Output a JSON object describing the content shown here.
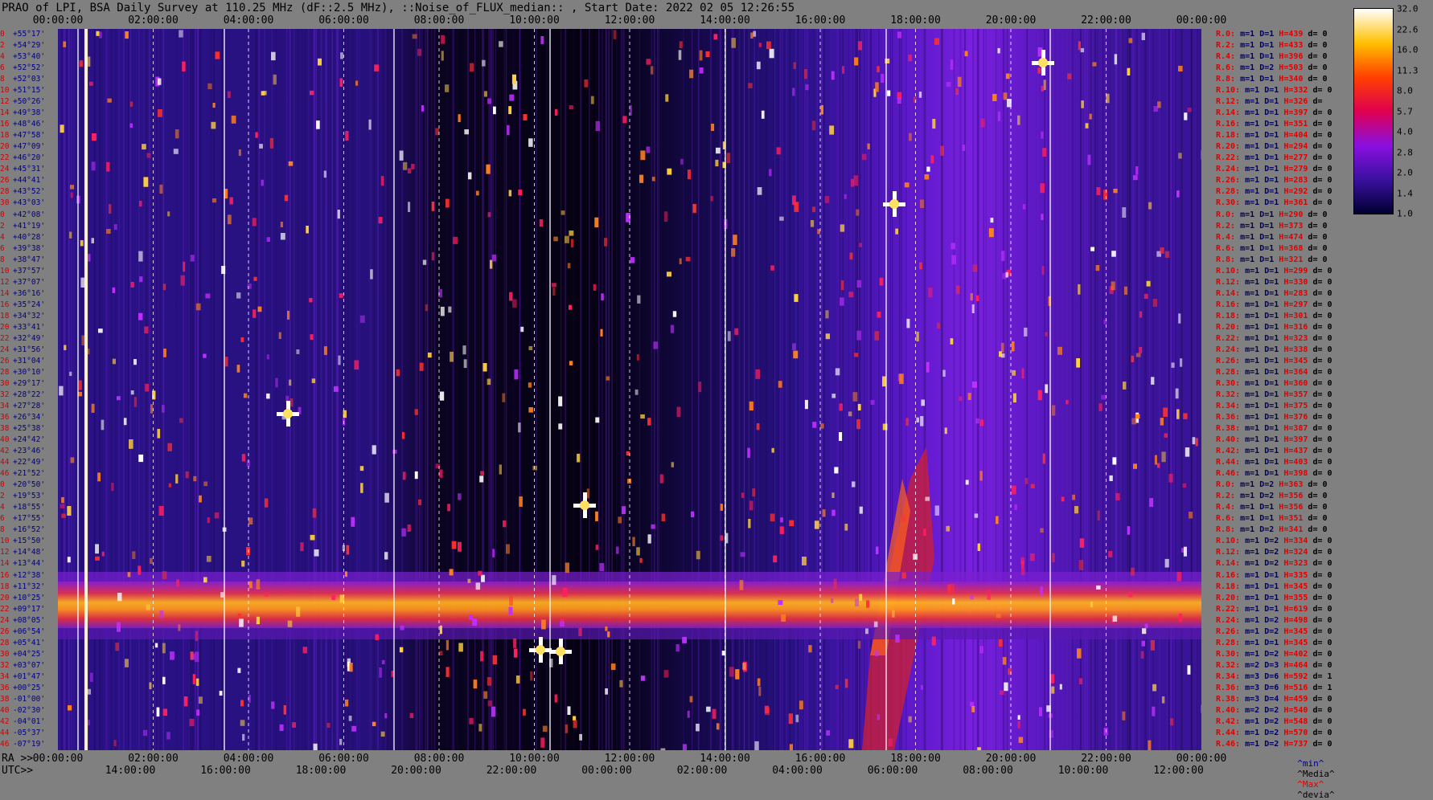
{
  "title": "PRAO of LPI, BSA Daily Survey at 110.25 MHz (dF::2.5 MHz), ::Noise_of_FLUX_median:: , Start Date: 2022 02 05 12:26:55",
  "chart_data": {
    "type": "heatmap",
    "top_ticks": [
      "00:00:00",
      "02:00:00",
      "04:00:00",
      "06:00:00",
      "08:00:00",
      "10:00:00",
      "12:00:00",
      "14:00:00",
      "16:00:00",
      "18:00:00",
      "20:00:00",
      "22:00:00",
      "00:00:00"
    ],
    "ra_prefix": "RA >>",
    "ra_ticks": [
      "00:00:00",
      "02:00:00",
      "04:00:00",
      "06:00:00",
      "08:00:00",
      "10:00:00",
      "12:00:00",
      "14:00:00",
      "16:00:00",
      "18:00:00",
      "20:00:00",
      "22:00:00",
      "00:00:00"
    ],
    "utc_prefix": "UTC>>",
    "utc_ticks": [
      "14:00:00",
      "16:00:00",
      "18:00:00",
      "20:00:00",
      "22:00:00",
      "00:00:00",
      "02:00:00",
      "04:00:00",
      "06:00:00",
      "08:00:00",
      "10:00:00",
      "12:00:00"
    ],
    "declinations": [
      {
        "idx": "0",
        "dec": "+55°17'"
      },
      {
        "idx": "2",
        "dec": "+54°29'"
      },
      {
        "idx": "4",
        "dec": "+53°40'"
      },
      {
        "idx": "6",
        "dec": "+52°52'"
      },
      {
        "idx": "8",
        "dec": "+52°03'"
      },
      {
        "idx": "10",
        "dec": "+51°15'"
      },
      {
        "idx": "12",
        "dec": "+50°26'"
      },
      {
        "idx": "14",
        "dec": "+49°38'"
      },
      {
        "idx": "16",
        "dec": "+48°46'"
      },
      {
        "idx": "18",
        "dec": "+47°58'"
      },
      {
        "idx": "20",
        "dec": "+47°09'"
      },
      {
        "idx": "22",
        "dec": "+46°20'"
      },
      {
        "idx": "24",
        "dec": "+45°31'"
      },
      {
        "idx": "26",
        "dec": "+44°41'"
      },
      {
        "idx": "28",
        "dec": "+43°52'"
      },
      {
        "idx": "30",
        "dec": "+43°03'"
      },
      {
        "idx": "0",
        "dec": "+42°08'"
      },
      {
        "idx": "2",
        "dec": "+41°19'"
      },
      {
        "idx": "4",
        "dec": "+40°28'"
      },
      {
        "idx": "6",
        "dec": "+39°38'"
      },
      {
        "idx": "8",
        "dec": "+38°47'"
      },
      {
        "idx": "10",
        "dec": "+37°57'"
      },
      {
        "idx": "12",
        "dec": "+37°07'"
      },
      {
        "idx": "14",
        "dec": "+36°16'"
      },
      {
        "idx": "16",
        "dec": "+35°24'"
      },
      {
        "idx": "18",
        "dec": "+34°32'"
      },
      {
        "idx": "20",
        "dec": "+33°41'"
      },
      {
        "idx": "22",
        "dec": "+32°49'"
      },
      {
        "idx": "24",
        "dec": "+31°56'"
      },
      {
        "idx": "26",
        "dec": "+31°04'"
      },
      {
        "idx": "28",
        "dec": "+30°10'"
      },
      {
        "idx": "30",
        "dec": "+29°17'"
      },
      {
        "idx": "32",
        "dec": "+28°22'"
      },
      {
        "idx": "34",
        "dec": "+27°28'"
      },
      {
        "idx": "36",
        "dec": "+26°34'"
      },
      {
        "idx": "38",
        "dec": "+25°38'"
      },
      {
        "idx": "40",
        "dec": "+24°42'"
      },
      {
        "idx": "42",
        "dec": "+23°46'"
      },
      {
        "idx": "44",
        "dec": "+22°49'"
      },
      {
        "idx": "46",
        "dec": "+21°52'"
      },
      {
        "idx": "0",
        "dec": "+20°50'"
      },
      {
        "idx": "2",
        "dec": "+19°53'"
      },
      {
        "idx": "4",
        "dec": "+18°55'"
      },
      {
        "idx": "6",
        "dec": "+17°55'"
      },
      {
        "idx": "8",
        "dec": "+16°52'"
      },
      {
        "idx": "10",
        "dec": "+15°50'"
      },
      {
        "idx": "12",
        "dec": "+14°48'"
      },
      {
        "idx": "14",
        "dec": "+13°44'"
      },
      {
        "idx": "16",
        "dec": "+12°38'"
      },
      {
        "idx": "18",
        "dec": "+11°32'"
      },
      {
        "idx": "20",
        "dec": "+10°25'"
      },
      {
        "idx": "22",
        "dec": "+09°17'"
      },
      {
        "idx": "24",
        "dec": "+08°05'"
      },
      {
        "idx": "26",
        "dec": "+06°54'"
      },
      {
        "idx": "28",
        "dec": "+05°41'"
      },
      {
        "idx": "30",
        "dec": "+04°25'"
      },
      {
        "idx": "32",
        "dec": "+03°07'"
      },
      {
        "idx": "34",
        "dec": "+01°47'"
      },
      {
        "idx": "36",
        "dec": "+00°25'"
      },
      {
        "idx": "38",
        "dec": "-01°00'"
      },
      {
        "idx": "40",
        "dec": "-02°30'"
      },
      {
        "idx": "42",
        "dec": "-04°01'"
      },
      {
        "idx": "44",
        "dec": "-05°37'"
      },
      {
        "idx": "46",
        "dec": "-07°19'"
      }
    ],
    "receivers": [
      {
        "id": "R.0:",
        "m": "m=1",
        "d": "D=1",
        "h": "H=439",
        "dd": "d= 0"
      },
      {
        "id": "R.2:",
        "m": "m=1",
        "d": "D=1",
        "h": "H=433",
        "dd": "d= 0"
      },
      {
        "id": "R.4:",
        "m": "m=1",
        "d": "D=1",
        "h": "H=396",
        "dd": "d= 0"
      },
      {
        "id": "R.6:",
        "m": "m=1",
        "d": "D=2",
        "h": "H=503",
        "dd": "d= 0"
      },
      {
        "id": "R.8:",
        "m": "m=1",
        "d": "D=1",
        "h": "H=340",
        "dd": "d= 0"
      },
      {
        "id": "R.10:",
        "m": "m=1",
        "d": "D=1",
        "h": "H=332",
        "dd": "d= 0"
      },
      {
        "id": "R.12:",
        "m": "m=1",
        "d": "D=1",
        "h": "H=326",
        "dd": "d="
      },
      {
        "id": "R.14:",
        "m": "m=1",
        "d": "D=1",
        "h": "H=397",
        "dd": "d= 0"
      },
      {
        "id": "R.16:",
        "m": "m=1",
        "d": "D=1",
        "h": "H=351",
        "dd": "d= 0"
      },
      {
        "id": "R.18:",
        "m": "m=1",
        "d": "D=1",
        "h": "H=404",
        "dd": "d= 0"
      },
      {
        "id": "R.20:",
        "m": "m=1",
        "d": "D=1",
        "h": "H=294",
        "dd": "d= 0"
      },
      {
        "id": "R.22:",
        "m": "m=1",
        "d": "D=1",
        "h": "H=277",
        "dd": "d= 0"
      },
      {
        "id": "R.24:",
        "m": "m=1",
        "d": "D=1",
        "h": "H=279",
        "dd": "d= 0"
      },
      {
        "id": "R.26:",
        "m": "m=1",
        "d": "D=1",
        "h": "H=283",
        "dd": "d= 0"
      },
      {
        "id": "R.28:",
        "m": "m=1",
        "d": "D=1",
        "h": "H=292",
        "dd": "d= 0"
      },
      {
        "id": "R.30:",
        "m": "m=1",
        "d": "D=1",
        "h": "H=361",
        "dd": "d= 0"
      },
      {
        "id": "R.0:",
        "m": "m=1",
        "d": "D=1",
        "h": "H=290",
        "dd": "d= 0"
      },
      {
        "id": "R.2:",
        "m": "m=1",
        "d": "D=1",
        "h": "H=373",
        "dd": "d= 0"
      },
      {
        "id": "R.4:",
        "m": "m=1",
        "d": "D=1",
        "h": "H=474",
        "dd": "d= 0"
      },
      {
        "id": "R.6:",
        "m": "m=1",
        "d": "D=1",
        "h": "H=368",
        "dd": "d= 0"
      },
      {
        "id": "R.8:",
        "m": "m=1",
        "d": "D=1",
        "h": "H=321",
        "dd": "d= 0"
      },
      {
        "id": "R.10:",
        "m": "m=1",
        "d": "D=1",
        "h": "H=299",
        "dd": "d= 0"
      },
      {
        "id": "R.12:",
        "m": "m=1",
        "d": "D=1",
        "h": "H=330",
        "dd": "d= 0"
      },
      {
        "id": "R.14:",
        "m": "m=1",
        "d": "D=1",
        "h": "H=283",
        "dd": "d= 0"
      },
      {
        "id": "R.16:",
        "m": "m=1",
        "d": "D=1",
        "h": "H=297",
        "dd": "d= 0"
      },
      {
        "id": "R.18:",
        "m": "m=1",
        "d": "D=1",
        "h": "H=301",
        "dd": "d= 0"
      },
      {
        "id": "R.20:",
        "m": "m=1",
        "d": "D=1",
        "h": "H=316",
        "dd": "d= 0"
      },
      {
        "id": "R.22:",
        "m": "m=1",
        "d": "D=1",
        "h": "H=323",
        "dd": "d= 0"
      },
      {
        "id": "R.24:",
        "m": "m=1",
        "d": "D=1",
        "h": "H=338",
        "dd": "d= 0"
      },
      {
        "id": "R.26:",
        "m": "m=1",
        "d": "D=1",
        "h": "H=345",
        "dd": "d= 0"
      },
      {
        "id": "R.28:",
        "m": "m=1",
        "d": "D=1",
        "h": "H=364",
        "dd": "d= 0"
      },
      {
        "id": "R.30:",
        "m": "m=1",
        "d": "D=1",
        "h": "H=360",
        "dd": "d= 0"
      },
      {
        "id": "R.32:",
        "m": "m=1",
        "d": "D=1",
        "h": "H=357",
        "dd": "d= 0"
      },
      {
        "id": "R.34:",
        "m": "m=1",
        "d": "D=1",
        "h": "H=375",
        "dd": "d= 0"
      },
      {
        "id": "R.36:",
        "m": "m=1",
        "d": "D=1",
        "h": "H=376",
        "dd": "d= 0"
      },
      {
        "id": "R.38:",
        "m": "m=1",
        "d": "D=1",
        "h": "H=387",
        "dd": "d= 0"
      },
      {
        "id": "R.40:",
        "m": "m=1",
        "d": "D=1",
        "h": "H=397",
        "dd": "d= 0"
      },
      {
        "id": "R.42:",
        "m": "m=1",
        "d": "D=1",
        "h": "H=437",
        "dd": "d= 0"
      },
      {
        "id": "R.44:",
        "m": "m=1",
        "d": "D=1",
        "h": "H=403",
        "dd": "d= 0"
      },
      {
        "id": "R.46:",
        "m": "m=1",
        "d": "D=1",
        "h": "H=398",
        "dd": "d= 0"
      },
      {
        "id": "R.0:",
        "m": "m=1",
        "d": "D=2",
        "h": "H=363",
        "dd": "d= 0"
      },
      {
        "id": "R.2:",
        "m": "m=1",
        "d": "D=2",
        "h": "H=356",
        "dd": "d= 0"
      },
      {
        "id": "R.4:",
        "m": "m=1",
        "d": "D=1",
        "h": "H=356",
        "dd": "d= 0"
      },
      {
        "id": "R.6:",
        "m": "m=1",
        "d": "D=1",
        "h": "H=351",
        "dd": "d= 0"
      },
      {
        "id": "R.8:",
        "m": "m=1",
        "d": "D=2",
        "h": "H=341",
        "dd": "d= 0"
      },
      {
        "id": "R.10:",
        "m": "m=1",
        "d": "D=2",
        "h": "H=334",
        "dd": "d= 0"
      },
      {
        "id": "R.12:",
        "m": "m=1",
        "d": "D=2",
        "h": "H=324",
        "dd": "d= 0"
      },
      {
        "id": "R.14:",
        "m": "m=1",
        "d": "D=2",
        "h": "H=323",
        "dd": "d= 0"
      },
      {
        "id": "R.16:",
        "m": "m=1",
        "d": "D=1",
        "h": "H=335",
        "dd": "d= 0"
      },
      {
        "id": "R.18:",
        "m": "m=1",
        "d": "D=1",
        "h": "H=345",
        "dd": "d= 0"
      },
      {
        "id": "R.20:",
        "m": "m=1",
        "d": "D=1",
        "h": "H=355",
        "dd": "d= 0"
      },
      {
        "id": "R.22:",
        "m": "m=1",
        "d": "D=1",
        "h": "H=619",
        "dd": "d= 0"
      },
      {
        "id": "R.24:",
        "m": "m=1",
        "d": "D=2",
        "h": "H=498",
        "dd": "d= 0"
      },
      {
        "id": "R.26:",
        "m": "m=1",
        "d": "D=2",
        "h": "H=345",
        "dd": "d= 0"
      },
      {
        "id": "R.28:",
        "m": "m=1",
        "d": "D=1",
        "h": "H=345",
        "dd": "d= 0"
      },
      {
        "id": "R.30:",
        "m": "m=1",
        "d": "D=2",
        "h": "H=402",
        "dd": "d= 0"
      },
      {
        "id": "R.32:",
        "m": "m=2",
        "d": "D=3",
        "h": "H=464",
        "dd": "d= 0"
      },
      {
        "id": "R.34:",
        "m": "m=3",
        "d": "D=6",
        "h": "H=592",
        "dd": "d= 1"
      },
      {
        "id": "R.36:",
        "m": "m=3",
        "d": "D=6",
        "h": "H=516",
        "dd": "d= 1"
      },
      {
        "id": "R.38:",
        "m": "m=3",
        "d": "D=4",
        "h": "H=459",
        "dd": "d= 0"
      },
      {
        "id": "R.40:",
        "m": "m=2",
        "d": "D=2",
        "h": "H=540",
        "dd": "d= 0"
      },
      {
        "id": "R.42:",
        "m": "m=1",
        "d": "D=2",
        "h": "H=548",
        "dd": "d= 0"
      },
      {
        "id": "R.44:",
        "m": "m=1",
        "d": "D=2",
        "h": "H=570",
        "dd": "d= 0"
      },
      {
        "id": "R.46:",
        "m": "m=1",
        "d": "D=2",
        "h": "H=737",
        "dd": "d= 0"
      }
    ],
    "legend": {
      "min": "^min^",
      "median": "^Media^",
      "max": "^Max^",
      "devia": "^devia^"
    },
    "colorbar": {
      "ticks": [
        "32.0",
        "22.6",
        "16.0",
        "11.3",
        "8.0",
        "5.7",
        "4.0",
        "2.8",
        "2.0",
        "1.4",
        "1.0"
      ],
      "range": [
        1.0,
        32.0
      ],
      "scale": "log",
      "colors": [
        "#000030",
        "#3a10a0",
        "#8a10e0",
        "#e00050",
        "#ff4000",
        "#ffc000",
        "#ffffff"
      ]
    }
  }
}
